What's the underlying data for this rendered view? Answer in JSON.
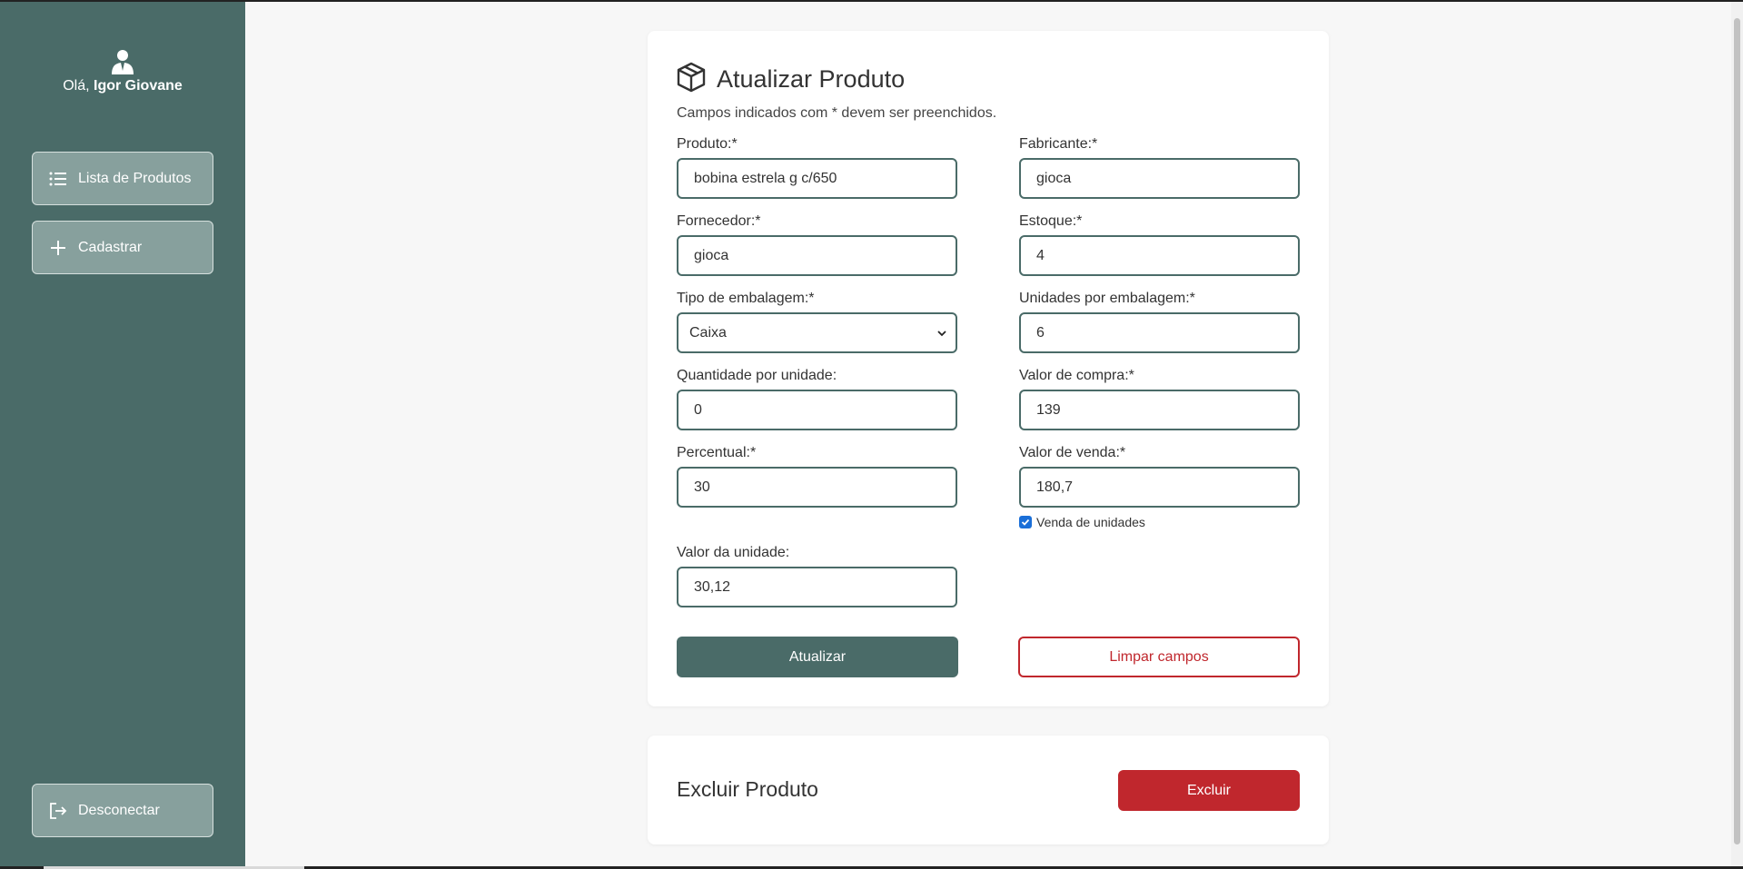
{
  "sidebar": {
    "greeting_prefix": "Olá,",
    "user_name": "Igor Giovane",
    "nav": {
      "lista": "Lista de Produtos",
      "cadastrar": "Cadastrar"
    },
    "logout": "Desconectar"
  },
  "form": {
    "title": "Atualizar Produto",
    "subtitle": "Campos indicados com * devem ser preenchidos.",
    "fields": {
      "produto": {
        "label": "Produto:*",
        "value": "bobina estrela g c/650"
      },
      "fabricante": {
        "label": "Fabricante:*",
        "value": "gioca"
      },
      "fornecedor": {
        "label": "Fornecedor:*",
        "value": "gioca"
      },
      "estoque": {
        "label": "Estoque:*",
        "value": "4"
      },
      "tipo_embalagem": {
        "label": "Tipo de embalagem:*",
        "value": "Caixa"
      },
      "unidades_embalagem": {
        "label": "Unidades por embalagem:*",
        "value": "6"
      },
      "quantidade_unidade": {
        "label": "Quantidade por unidade:",
        "value": "0"
      },
      "valor_compra": {
        "label": "Valor de compra:*",
        "value": "139"
      },
      "percentual": {
        "label": "Percentual:*",
        "value": "30"
      },
      "valor_venda": {
        "label": "Valor de venda:*",
        "value": "180,7"
      },
      "valor_unidade": {
        "label": "Valor da unidade:",
        "value": "30,12"
      }
    },
    "venda_unidades": {
      "label": "Venda de unidades",
      "checked": true
    },
    "submit_label": "Atualizar",
    "clear_label": "Limpar campos"
  },
  "delete": {
    "title": "Excluir Produto",
    "button_label": "Excluir"
  },
  "colors": {
    "sidebar": "#4a6b68",
    "primary": "#4a6b68",
    "danger": "#c0272d",
    "checkbox": "#1a6fd8"
  }
}
